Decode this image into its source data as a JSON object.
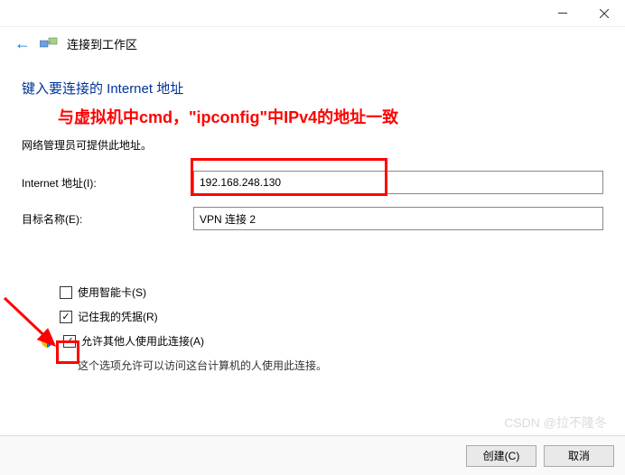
{
  "window": {
    "title": "连接到工作区"
  },
  "heading": "键入要连接的 Internet 地址",
  "annotation": "与虚拟机中cmd，\"ipconfig\"中IPv4的地址一致",
  "subtext": "网络管理员可提供此地址。",
  "form": {
    "address_label": "Internet 地址(I):",
    "address_value": "192.168.248.130",
    "destname_label": "目标名称(E):",
    "destname_value": "VPN 连接 2"
  },
  "options": {
    "smartcard": {
      "label": "使用智能卡(S)",
      "checked": false
    },
    "remember": {
      "label": "记住我的凭据(R)",
      "checked": true
    },
    "allow": {
      "label": "允许其他人使用此连接(A)",
      "checked": true
    },
    "allow_desc": "这个选项允许可以访问这台计算机的人使用此连接。"
  },
  "buttons": {
    "create": "创建(C)",
    "cancel": "取消"
  },
  "watermark": "CSDN @拉不隆冬"
}
